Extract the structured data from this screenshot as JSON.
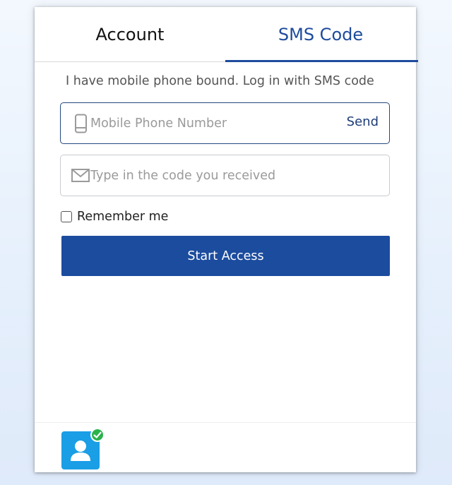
{
  "tabs": {
    "account_label": "Account",
    "sms_label": "SMS Code",
    "active": "SMS Code"
  },
  "hint": "I have mobile phone bound. Log in with SMS code",
  "phone_field": {
    "placeholder": "Mobile Phone Number",
    "value": "",
    "icon": "mobile-phone-icon",
    "send_label": "Send"
  },
  "code_field": {
    "placeholder": "Type in the code you received",
    "value": "",
    "icon": "envelope-icon"
  },
  "remember": {
    "label": "Remember me",
    "checked": false
  },
  "start_button": {
    "label": "Start Access"
  },
  "footer": {
    "avatar_icon": "user-avatar-icon",
    "badge_icon": "verified-check-icon"
  },
  "colors": {
    "accent": "#1c4c9e",
    "tab_active_text": "#1d4b9d",
    "avatar_bg": "#1a9ee6",
    "badge": "#2bb24c"
  }
}
